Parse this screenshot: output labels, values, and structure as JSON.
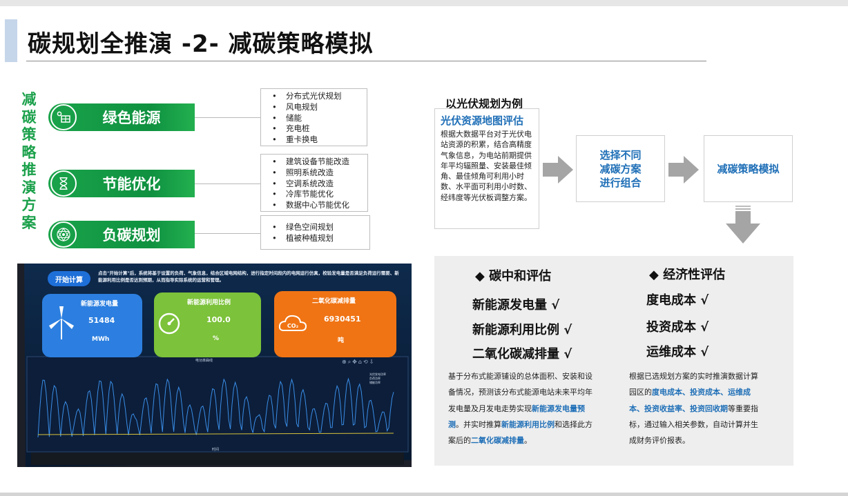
{
  "title": "碳规划全推演 -2- 减碳策略模拟",
  "vertical_label": "减碳策略推演方案",
  "strategies": [
    {
      "label": "绿色能源",
      "icon": "solar-panel-icon",
      "items": [
        "分布式光伏规划",
        "风电规划",
        "储能",
        "充电桩",
        "重卡换电"
      ]
    },
    {
      "label": "节能优化",
      "icon": "hourglass-icon",
      "items": [
        "建筑设备节能改造",
        "照明系统改造",
        "空调系统改造",
        "冷库节能优化",
        "数据中心节能优化"
      ]
    },
    {
      "label": "负碳规划",
      "icon": "network-star-icon",
      "items": [
        "绿色空间规划",
        "植被种植规划"
      ]
    }
  ],
  "flow": {
    "example_title": "以光伏规划为例",
    "step1_title": "光伏资源地图评估",
    "step1_body": "根据大数据平台对于光伏电站资源的积累，结合高精度气象信息，为电站前期提供年平均辐照量、安装最佳倾角、最佳倾角可利用小时数、水平面可利用小时数、经纬度等光伏板调整方案。",
    "step2": "选择不同减碳方案进行组合",
    "step3": "减碳策略模拟"
  },
  "carbon_eval": {
    "heading": "碳中和评估",
    "metrics": [
      "新能源发电量 √",
      "新能源利用比例 √",
      "二氧化碳减排量 √"
    ],
    "desc": [
      {
        "t": "基于分布式能源铺设的总体面积、安装和设备情况，预测该分布式能源电站未来平均年发电量及月发电走势实现",
        "h": false
      },
      {
        "t": "新能源发电量预测",
        "h": true
      },
      {
        "t": "。并实时推算",
        "h": false
      },
      {
        "t": "新能源利用比例",
        "h": true
      },
      {
        "t": "和选择此方案后的",
        "h": false
      },
      {
        "t": "二氧化碳减排量",
        "h": true
      },
      {
        "t": "。",
        "h": false
      }
    ]
  },
  "econ_eval": {
    "heading": "经济性评估",
    "metrics": [
      "度电成本 √",
      "投资成本 √",
      "运维成本 √"
    ],
    "desc": [
      {
        "t": "根据已选规划方案的实时推演数据计算园区的",
        "h": false
      },
      {
        "t": "度电成本、投资成本、运维成本、投资收益率、投资回收期",
        "h": true
      },
      {
        "t": "等重要指标，通过输入相关参数，自动计算并生成财务评价报表。",
        "h": false
      }
    ]
  },
  "screen": {
    "start_button": "开始计算",
    "note": "点击\"开始计算\"后，系统将基于设置的负荷、气象信息，结合区域电网结构，进行指定时间段内的电网运行仿真，校验发电量是否满足负荷运行需要、新能源利用比例是否达到预期，从而指导实际系统的运营和管理。",
    "cards": [
      {
        "title": "新能源发电量",
        "value": "51484",
        "unit": "MWh",
        "color": "#2c7fe0",
        "icon": "wind-turbine-icon"
      },
      {
        "title": "新能源利用比例",
        "value": "100.0",
        "unit": "%",
        "color": "#7cc23a",
        "icon": "gauge-icon"
      },
      {
        "title": "二氧化碳减排量",
        "value": "6930451",
        "unit": "吨",
        "color": "#f07414",
        "icon": "co2-cloud-icon"
      }
    ],
    "chart_title": "电功率曲线",
    "chart_xlabel": "时间",
    "chart_ylabel": "电功率(kW)",
    "legend": [
      "光伏发电功率",
      "负荷功率",
      "储能功率"
    ]
  }
}
